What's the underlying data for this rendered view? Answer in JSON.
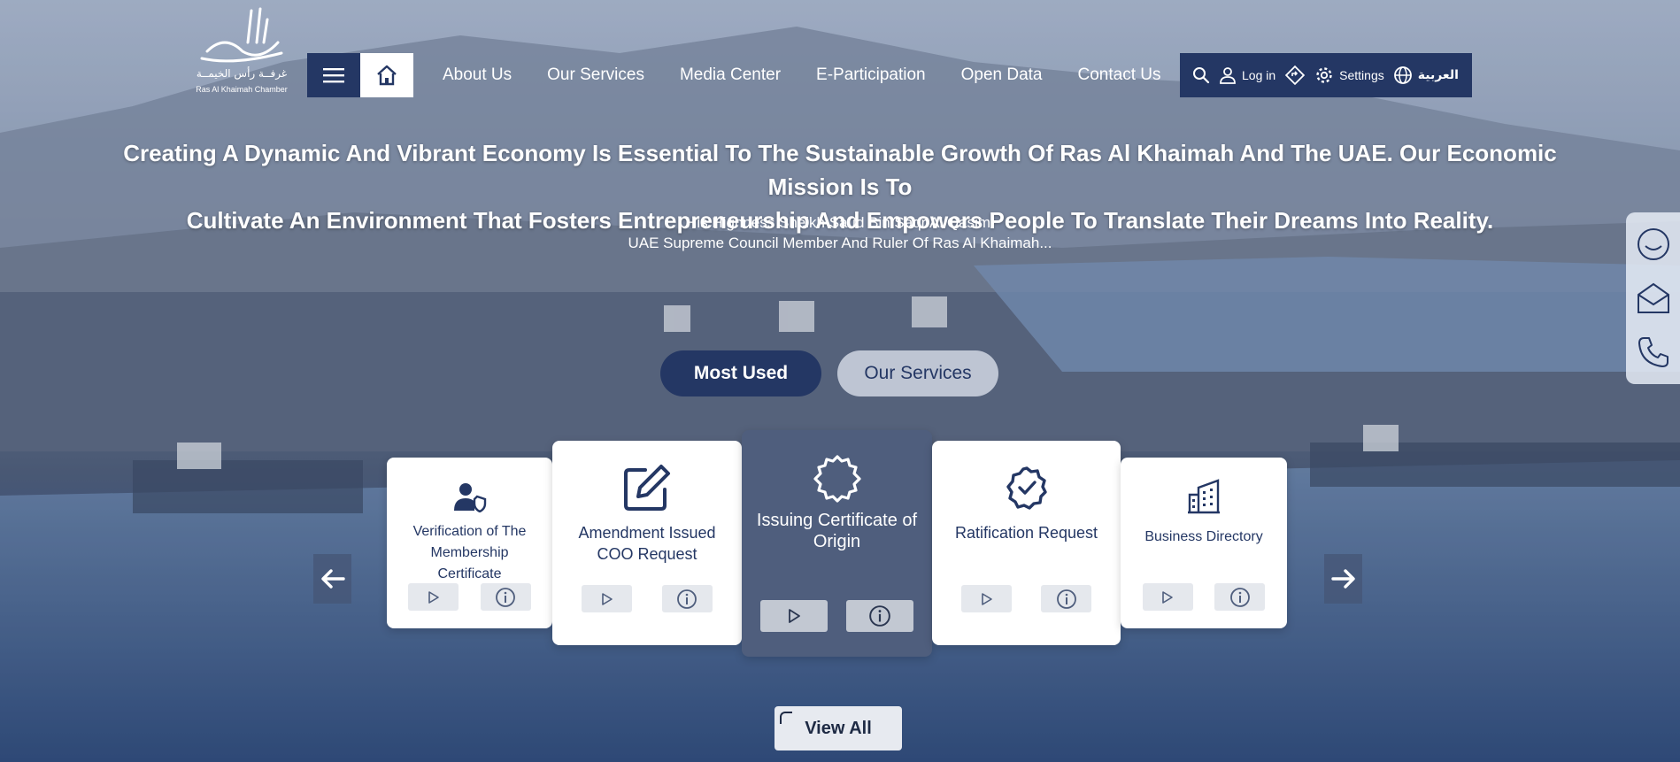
{
  "brand": {
    "logo_arabic": "غرفــة رأس الخيمــة",
    "logo_english": "Ras Al Khaimah Chamber"
  },
  "nav": {
    "items": [
      "About Us",
      "Our Services",
      "Media Center",
      "E-Participation",
      "Open Data",
      "Contact Us"
    ]
  },
  "utility": {
    "login": "Log in",
    "settings": "Settings",
    "language": "العربية"
  },
  "hero": {
    "quote_line1": "Creating A Dynamic And Vibrant Economy Is Essential To The Sustainable Growth Of Ras Al Khaimah And The UAE. Our Economic Mission Is To",
    "quote_line2": "Cultivate An Environment That Fosters Entrepreneurship And Empowers People To Translate Their Dreams Into Reality.",
    "author_name": "His Highness Sheikh Saud Bin Saqr Al Qasimi",
    "author_title": "UAE Supreme Council Member And Ruler Of Ras Al Khaimah..."
  },
  "tabs": {
    "most_used": "Most Used",
    "our_services": "Our Services"
  },
  "cards": [
    {
      "title": "Verification of The Membership Certificate",
      "icon": "user-shield-icon"
    },
    {
      "title": "Amendment Issued COO Request",
      "icon": "edit-square-icon"
    },
    {
      "title": "Issuing Certificate of Origin",
      "icon": "certificate-badge-icon"
    },
    {
      "title": "Ratification Request",
      "icon": "badge-check-icon"
    },
    {
      "title": "Business Directory",
      "icon": "building-icon"
    }
  ],
  "view_all": "View All",
  "colors": {
    "navy": "#243764",
    "active_card": "#4f5e7d",
    "white": "#ffffff"
  }
}
